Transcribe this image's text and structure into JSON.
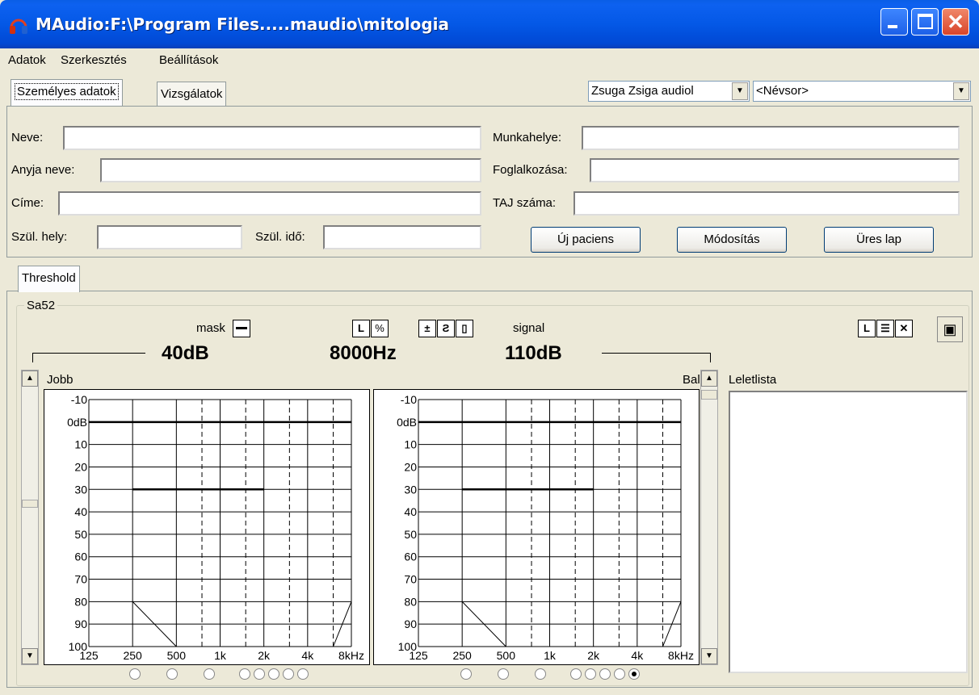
{
  "window": {
    "title": "MAudio:F:\\Program Files.....maudio\\mitologia"
  },
  "menu": [
    "Adatok",
    "Szerkesztés",
    "Beállítások"
  ],
  "tabs": {
    "personal": "Személyes adatok",
    "exams": "Vizsgálatok",
    "threshold": "Threshold"
  },
  "combos": {
    "doctor": "Zsuga Zsiga audiol",
    "patient": "<Névsor>"
  },
  "form": {
    "name": "Neve:",
    "mother": "Anyja neve:",
    "address": "Címe:",
    "birthplace": "Szül. hely:",
    "birthdate": "Szül. idő:",
    "workplace": "Munkahelye:",
    "occupation": "Foglalkozása:",
    "taj": "TAJ száma:"
  },
  "buttons": {
    "new_patient": "Új paciens",
    "modify": "Módosítás",
    "empty_page": "Üres lap"
  },
  "audiogram": {
    "group": "Sa52",
    "mask_label": "mask",
    "signal_label": "signal",
    "mask_value": "40dB",
    "freq_value": "8000Hz",
    "signal_value": "110dB",
    "right_ear": "Jobb",
    "left_ear": "Bal",
    "results_list": "Leletlista"
  },
  "chart_data": [
    {
      "type": "line",
      "title": "Jobb",
      "y_tick_labels": [
        "-10",
        "0dB",
        "10",
        "20",
        "30",
        "40",
        "50",
        "60",
        "70",
        "80",
        "90",
        "100"
      ],
      "x_tick_labels": [
        "125",
        "250",
        "500",
        "1k",
        "2k",
        "4k",
        "8kHz"
      ],
      "ylim": [
        -10,
        100
      ],
      "series": [
        {
          "x": [
            "125",
            "8kHz"
          ],
          "y": [
            0,
            0
          ]
        },
        {
          "x": [
            "250",
            "2k"
          ],
          "y": [
            30,
            30
          ]
        },
        {
          "x": [
            "250",
            "500"
          ],
          "y": [
            80,
            100
          ]
        },
        {
          "x": [
            "6k",
            "8kHz"
          ],
          "y": [
            100,
            80
          ]
        }
      ]
    },
    {
      "type": "line",
      "title": "Bal",
      "y_tick_labels": [
        "-10",
        "0dB",
        "10",
        "20",
        "30",
        "40",
        "50",
        "60",
        "70",
        "80",
        "90",
        "100"
      ],
      "x_tick_labels": [
        "125",
        "250",
        "500",
        "1k",
        "2k",
        "4k",
        "8kHz"
      ],
      "ylim": [
        -10,
        100
      ],
      "series": [
        {
          "x": [
            "125",
            "8kHz"
          ],
          "y": [
            0,
            0
          ]
        },
        {
          "x": [
            "250",
            "2k"
          ],
          "y": [
            30,
            30
          ]
        },
        {
          "x": [
            "250",
            "500"
          ],
          "y": [
            80,
            100
          ]
        },
        {
          "x": [
            "6k",
            "8kHz"
          ],
          "y": [
            100,
            80
          ]
        }
      ]
    }
  ]
}
